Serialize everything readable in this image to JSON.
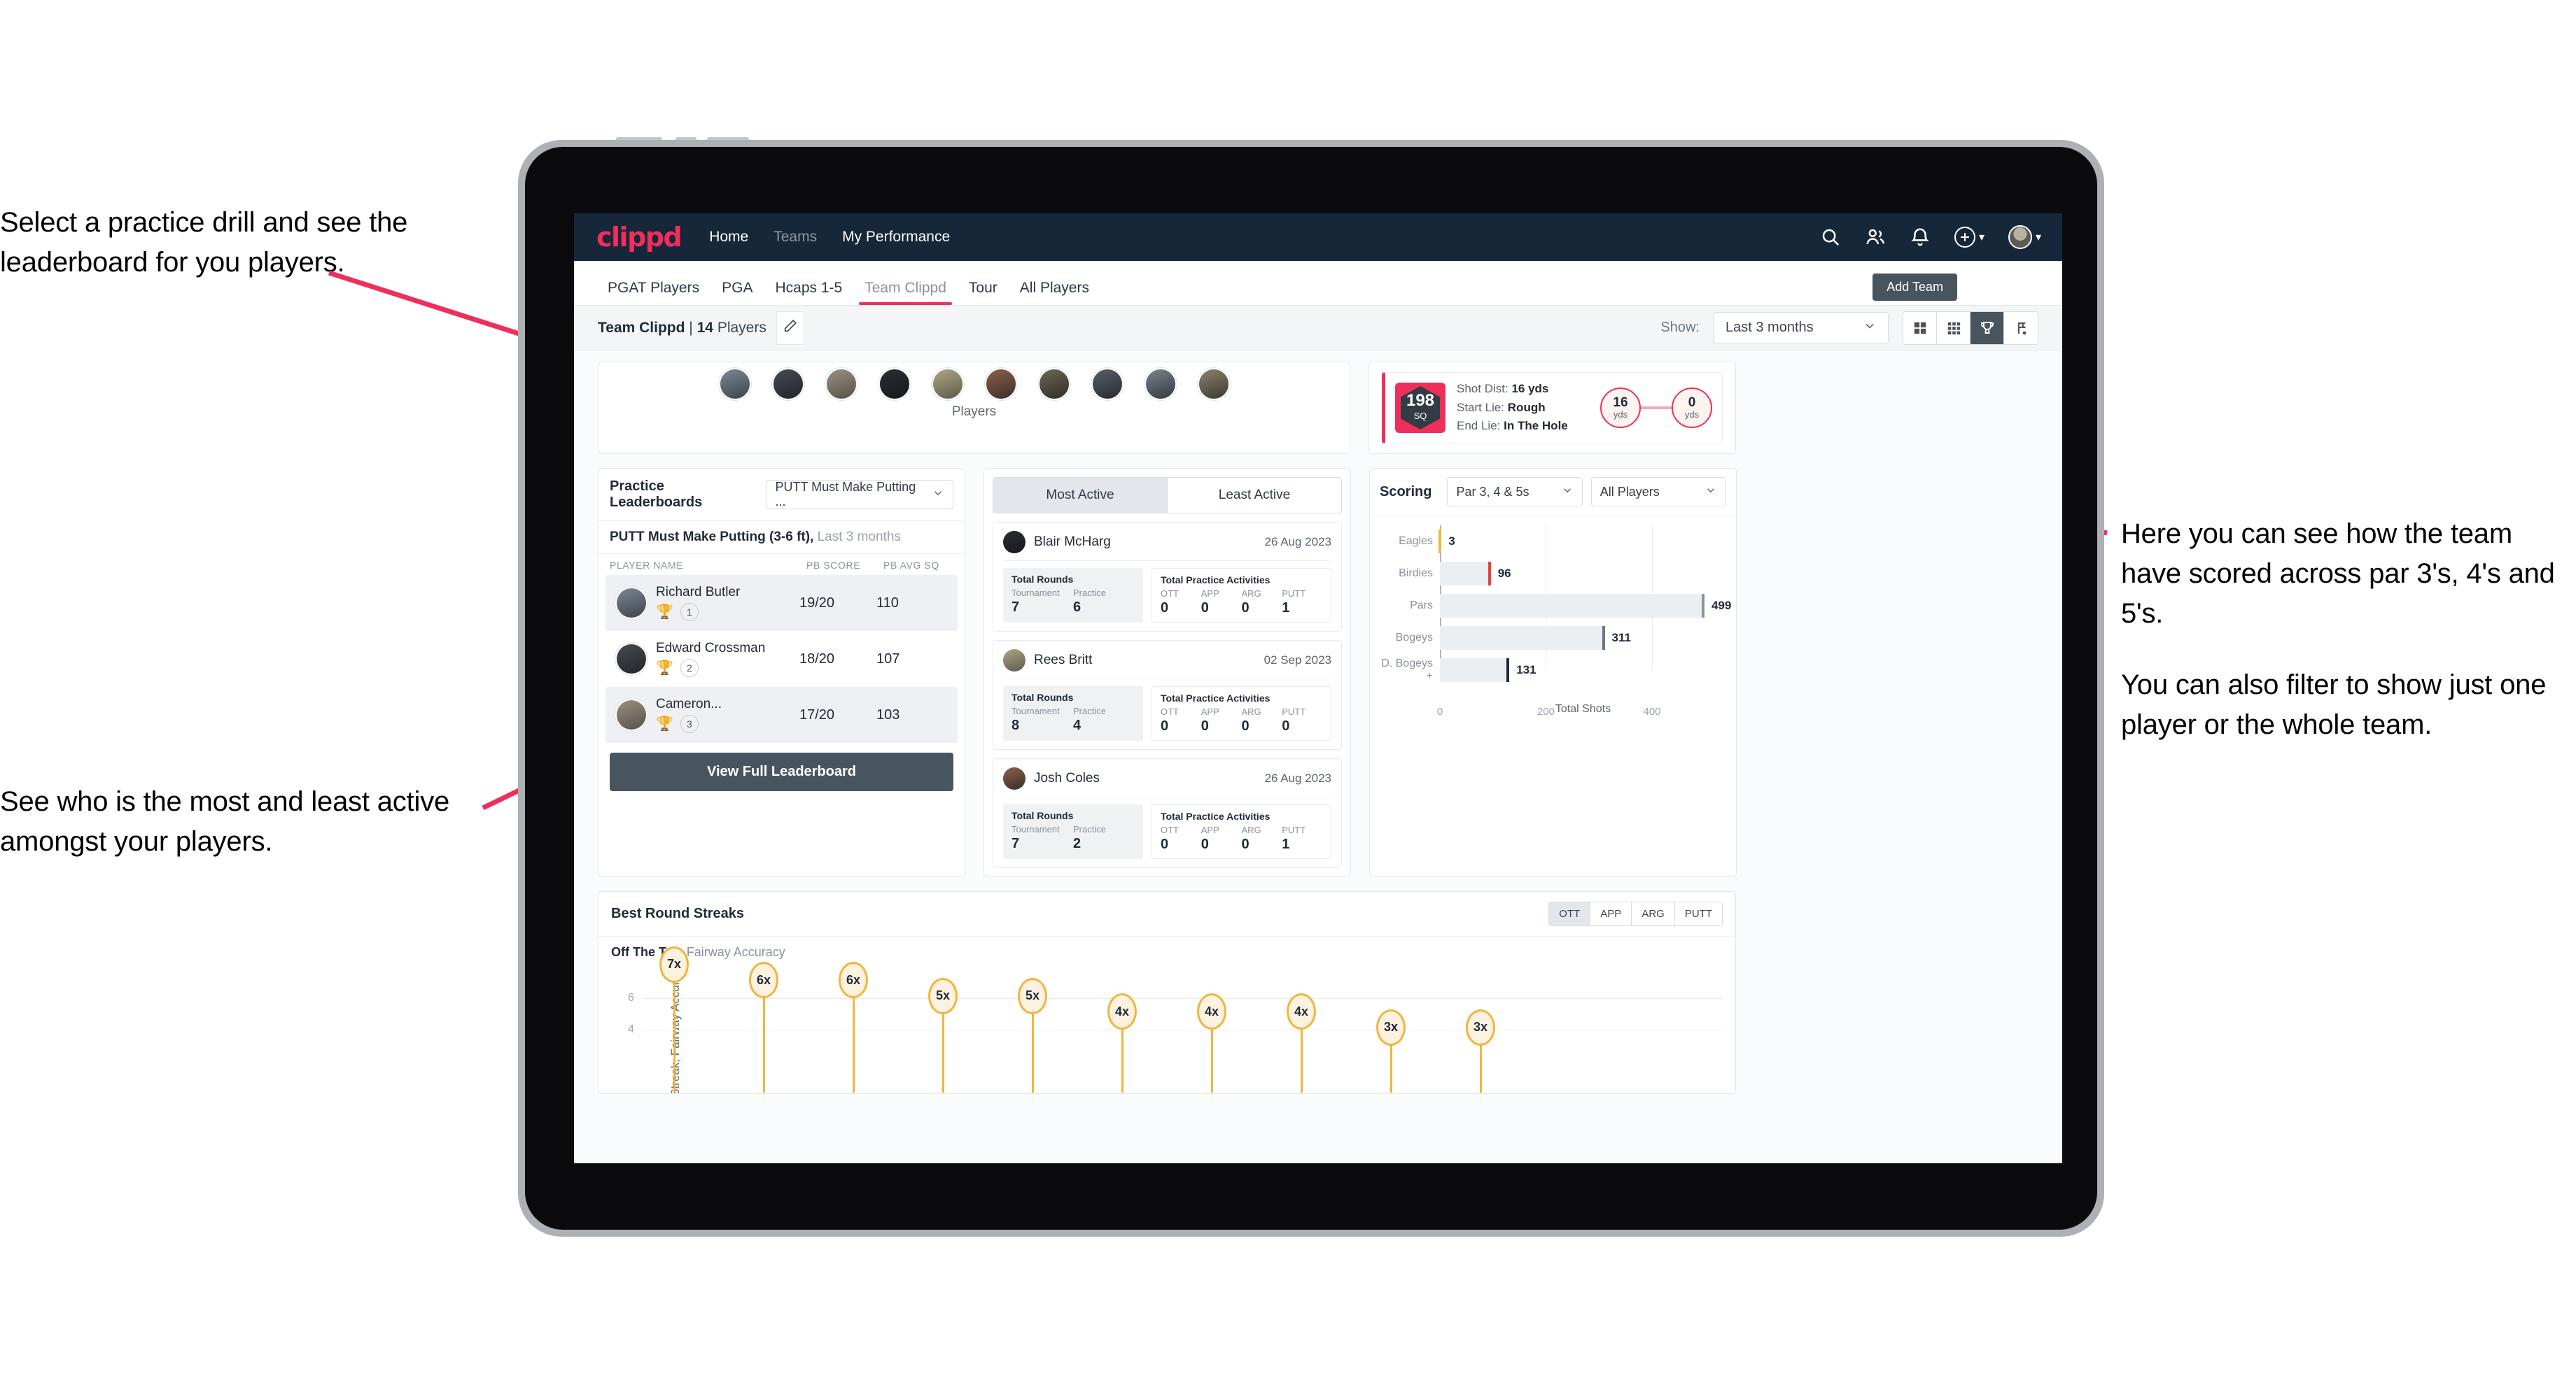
{
  "annotations": {
    "left_top": "Select a practice drill and see the leaderboard for you players.",
    "left_bottom": "See who is the most and least active amongst your players.",
    "right_para1": "Here you can see how the team have scored across par 3's, 4's and 5's.",
    "right_para2": "You can also filter to show just one player or the whole team."
  },
  "header": {
    "logo": "clippd",
    "nav": [
      {
        "label": "Home",
        "active": true
      },
      {
        "label": "Teams",
        "active": false
      },
      {
        "label": "My Performance",
        "active": true
      }
    ],
    "icons": [
      "search-icon",
      "people-icon",
      "bell-icon",
      "plus-circle-icon",
      "avatar"
    ],
    "add_button_label": "Add Team"
  },
  "tabs": [
    {
      "label": "PGAT Players",
      "active": false
    },
    {
      "label": "PGA",
      "active": false
    },
    {
      "label": "Hcaps 1-5",
      "active": false
    },
    {
      "label": "Team Clippd",
      "active": true
    },
    {
      "label": "Tour",
      "active": false
    },
    {
      "label": "All Players",
      "active": false
    }
  ],
  "subbar": {
    "team_name": "Team Clippd",
    "separator": "|",
    "player_count": "14",
    "players_word": "Players",
    "edit_icon": "pencil-icon",
    "show_label": "Show:",
    "period_value": "Last 3 months",
    "view_buttons": [
      {
        "name": "grid-large-icon",
        "active": false
      },
      {
        "name": "grid-small-icon",
        "active": false
      },
      {
        "name": "trophy-icon",
        "active": true
      },
      {
        "name": "golf-flag-icon",
        "active": false
      }
    ]
  },
  "players_card": {
    "caption": "Players",
    "count": 10
  },
  "shot_card": {
    "badge_value": "198",
    "badge_unit": "SQ",
    "shot_dist_label": "Shot Dist:",
    "shot_dist_value": "16 yds",
    "start_lie_label": "Start Lie:",
    "start_lie_value": "Rough",
    "end_lie_label": "End Lie:",
    "end_lie_value": "In The Hole",
    "from_value": "16",
    "from_unit": "yds",
    "to_value": "0",
    "to_unit": "yds"
  },
  "leaderboard": {
    "title": "Practice Leaderboards",
    "drill_select": "PUTT Must Make Putting ...",
    "drill_heading": "PUTT Must Make Putting (3-6 ft),",
    "drill_period": "Last 3 months",
    "columns": [
      "PLAYER NAME",
      "PB SCORE",
      "PB AVG SQ"
    ],
    "rows": [
      {
        "name": "Richard Butler",
        "rank": "1",
        "trophy": "gold",
        "score": "19/20",
        "avg_sq": "110"
      },
      {
        "name": "Edward Crossman",
        "rank": "2",
        "trophy": "silver",
        "score": "18/20",
        "avg_sq": "107"
      },
      {
        "name": "Cameron...",
        "rank": "3",
        "trophy": "bronze",
        "score": "17/20",
        "avg_sq": "103"
      }
    ],
    "button_label": "View Full Leaderboard"
  },
  "activity": {
    "tabs": [
      {
        "label": "Most Active",
        "active": true
      },
      {
        "label": "Least Active",
        "active": false
      }
    ],
    "rounds_title": "Total Rounds",
    "rounds_cols": [
      "Tournament",
      "Practice"
    ],
    "acts_title": "Total Practice Activities",
    "acts_cols": [
      "OTT",
      "APP",
      "ARG",
      "PUTT"
    ],
    "items": [
      {
        "name": "Blair McHarg",
        "date": "26 Aug 2023",
        "tournament": "7",
        "practice": "6",
        "ott": "0",
        "app": "0",
        "arg": "0",
        "putt": "1"
      },
      {
        "name": "Rees Britt",
        "date": "02 Sep 2023",
        "tournament": "8",
        "practice": "4",
        "ott": "0",
        "app": "0",
        "arg": "0",
        "putt": "0"
      },
      {
        "name": "Josh Coles",
        "date": "26 Aug 2023",
        "tournament": "7",
        "practice": "2",
        "ott": "0",
        "app": "0",
        "arg": "0",
        "putt": "1"
      }
    ]
  },
  "scoring": {
    "title": "Scoring",
    "par_filter": "Par 3, 4 & 5s",
    "player_filter": "All Players"
  },
  "streaks": {
    "title": "Best Round Streaks",
    "segments": [
      {
        "label": "OTT",
        "active": true
      },
      {
        "label": "APP",
        "active": false
      },
      {
        "label": "ARG",
        "active": false
      },
      {
        "label": "PUTT",
        "active": false
      }
    ],
    "subtitle_bold": "Off The Tee,",
    "subtitle_rest": "Fairway Accuracy"
  },
  "colors": {
    "brand_pink": "#ef2f5b",
    "header_navy": "#16273a",
    "dark_button": "#48555f",
    "gold": "#f0b53f"
  },
  "chart_data": [
    {
      "type": "bar",
      "orientation": "horizontal",
      "title": "Scoring",
      "categories": [
        "Eagles",
        "Birdies",
        "Pars",
        "Bogeys",
        "D. Bogeys +"
      ],
      "values": [
        3,
        96,
        499,
        311,
        131
      ],
      "cap_colors": [
        "#f0b53f",
        "#e8403c",
        "#8a929c",
        "#6b7682",
        "#1f2b38"
      ],
      "xlabel": "Total Shots",
      "ylabel": "",
      "xlim": [
        0,
        540
      ],
      "xticks": [
        0,
        200,
        400
      ],
      "grid": true,
      "legend": "none"
    },
    {
      "type": "scatter",
      "title": "Best Round Streaks",
      "subtitle": "Off The Tee, Fairway Accuracy",
      "ylabel": "Streak, Fairway Accuracy",
      "values": [
        7,
        6,
        6,
        5,
        5,
        4,
        4,
        4,
        3,
        3
      ],
      "labels": [
        "7x",
        "6x",
        "6x",
        "5x",
        "5x",
        "4x",
        "4x",
        "4x",
        "3x",
        "3x"
      ],
      "yticks": [
        4,
        6
      ],
      "ylim": [
        0,
        8
      ],
      "grid": true,
      "legend": "none"
    }
  ]
}
